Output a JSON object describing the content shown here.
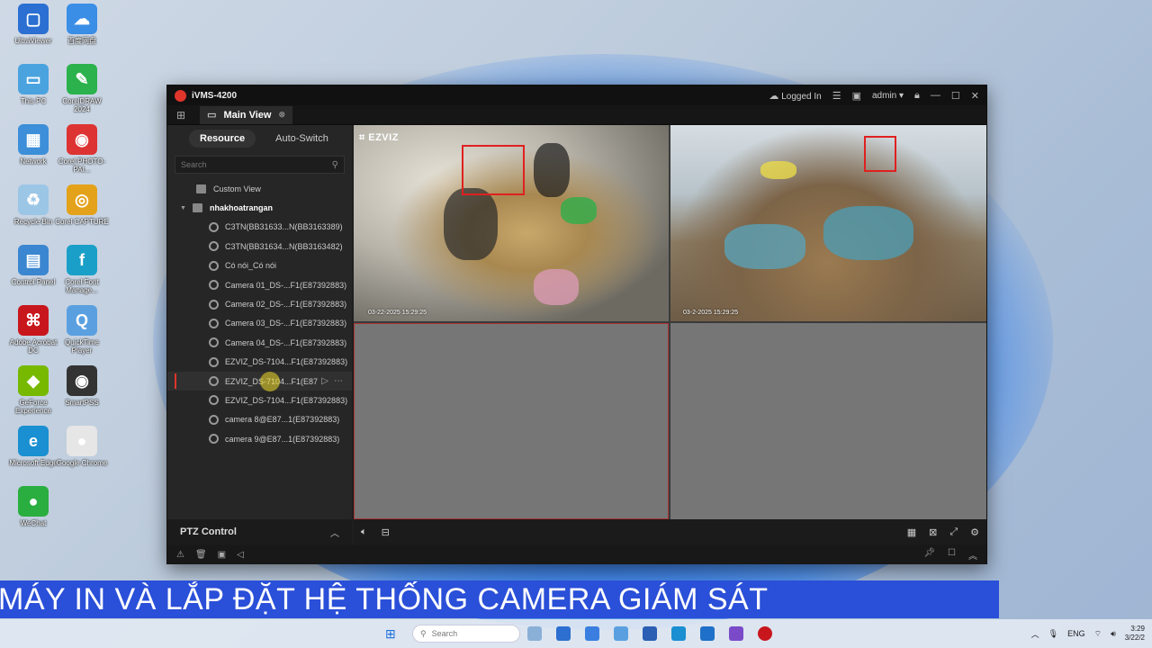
{
  "desktop": {
    "icons": [
      {
        "label": "UltraViewer",
        "color": "#2a6fd1",
        "glyph": "▢"
      },
      {
        "label": "百度网盘",
        "color": "#3a8ee6",
        "glyph": "☁"
      },
      {
        "label": "This PC",
        "color": "#4aa3df",
        "glyph": "▭"
      },
      {
        "label": "CorelDRAW 2024",
        "color": "#2bb24c",
        "glyph": "✎"
      },
      {
        "label": "Network",
        "color": "#3c8fd8",
        "glyph": "▦"
      },
      {
        "label": "Corel PHOTO-PAI...",
        "color": "#d33",
        "glyph": "◉"
      },
      {
        "label": "Recycle Bin",
        "color": "#9cc6e6",
        "glyph": "♻"
      },
      {
        "label": "Corel CAPTURE",
        "color": "#e3a21a",
        "glyph": "◎"
      },
      {
        "label": "Control Panel",
        "color": "#3b86d0",
        "glyph": "▤"
      },
      {
        "label": "Corel Font Manage...",
        "color": "#1aa0c8",
        "glyph": "f"
      },
      {
        "label": "Adobe Acrobat DC",
        "color": "#c8161d",
        "glyph": "⌘"
      },
      {
        "label": "QuickTime Player",
        "color": "#5aa0e0",
        "glyph": "Q"
      },
      {
        "label": "GeForce Experience",
        "color": "#76b900",
        "glyph": "◆"
      },
      {
        "label": "SmartPSS",
        "color": "#333",
        "glyph": "◉"
      },
      {
        "label": "Microsoft Edge",
        "color": "#1a8fd1",
        "glyph": "e"
      },
      {
        "label": "Google Chrome",
        "color": "#e6e6e6",
        "glyph": "●"
      },
      {
        "label": "WeChat",
        "color": "#2aae3f",
        "glyph": "●"
      }
    ]
  },
  "window": {
    "title": "iVMS-4200",
    "login_status": "Logged In",
    "user": "admin",
    "tab_main": "Main View"
  },
  "sidebar": {
    "tab_resource": "Resource",
    "tab_autoswitch": "Auto-Switch",
    "search_placeholder": "Search",
    "custom_view": "Custom View",
    "group": "nhakhoatrangan",
    "cameras": [
      "C3TN(BB31633...N(BB3163389)",
      "C3TN(BB31634...N(BB3163482)",
      "Có nói_Có nói",
      "Camera 01_DS-...F1(E87392883)",
      "Camera 02_DS-...F1(E87392883)",
      "Camera 03_DS-...F1(E87392883)",
      "Camera 04_DS-...F1(E87392883)",
      "EZVIZ_DS-7104...F1(E87392883)",
      "EZVIZ_DS-7104...F1(E87",
      "EZVIZ_DS-7104...F1(E87392883)",
      "camera 8@E87...1(E87392883)",
      "camera 9@E87...1(E87392883)"
    ],
    "selected_index": 8
  },
  "ptz": {
    "label": "PTZ Control"
  },
  "video": {
    "cell1": {
      "brand": "EZVIZ",
      "timestamp": "03-22-2025  15:29:25"
    },
    "cell2": {
      "timestamp": "03-2-2025  15:29:25"
    }
  },
  "banner": {
    "text": "MÁY IN VÀ LẮP ĐẶT HỆ THỐNG CAMERA GIÁM SÁT"
  },
  "taskbar": {
    "search_placeholder": "Search",
    "lang": "ENG",
    "time": "3:29",
    "date": "3/22/2"
  }
}
